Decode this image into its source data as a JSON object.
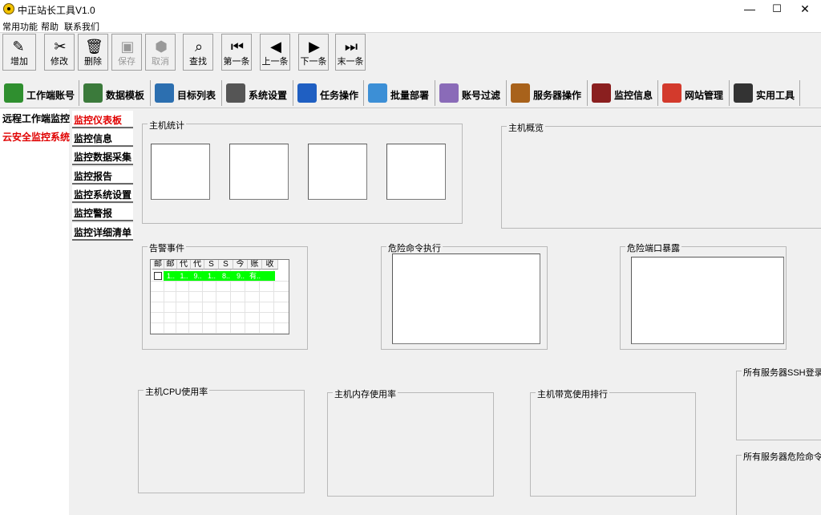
{
  "window": {
    "title": "中正站长工具V1.0",
    "controls": {
      "minimize": "—",
      "maximize": "☐",
      "close": "✕"
    }
  },
  "menu": [
    "常用功能",
    "帮助",
    "联系我们"
  ],
  "toolbar": [
    {
      "label": "增加",
      "icon": "add-icon",
      "glyph": "✎",
      "enabled": true
    },
    {
      "label": "修改",
      "icon": "edit-tools-icon",
      "glyph": "✂",
      "enabled": true
    },
    {
      "label": "删除",
      "icon": "trash-icon",
      "glyph": "🗑",
      "enabled": true
    },
    {
      "label": "保存",
      "icon": "save-icon",
      "glyph": "▣",
      "enabled": false
    },
    {
      "label": "取消",
      "icon": "cancel-icon",
      "glyph": "⬢",
      "enabled": false
    },
    {
      "label": "查找",
      "icon": "find-icon",
      "glyph": "⌕",
      "enabled": true
    },
    {
      "label": "第一条",
      "icon": "first-record-icon",
      "glyph": "⏮",
      "enabled": true
    },
    {
      "label": "上一条",
      "icon": "previous-record-icon",
      "glyph": "◀",
      "enabled": true
    },
    {
      "label": "下一条",
      "icon": "next-record-icon",
      "glyph": "▶",
      "enabled": true
    },
    {
      "label": "末一条",
      "icon": "last-record-icon",
      "glyph": "⏭",
      "enabled": true
    }
  ],
  "tabs": [
    {
      "label": "工作端账号",
      "icon": "account-card-icon",
      "color": "#2f8f2f"
    },
    {
      "label": "数据模板",
      "icon": "template-icon",
      "color": "#3b7a3b"
    },
    {
      "label": "目标列表",
      "icon": "target-folder-icon",
      "color": "#2c6fb0"
    },
    {
      "label": "系统设置",
      "icon": "wrench-icon",
      "color": "#555555"
    },
    {
      "label": "任务操作",
      "icon": "globe-icon",
      "color": "#1f5fc2"
    },
    {
      "label": "批量部署",
      "icon": "deploy-icon",
      "color": "#3c8fd6"
    },
    {
      "label": "账号过滤",
      "icon": "filter-folder-icon",
      "color": "#8a6bb8"
    },
    {
      "label": "服务器操作",
      "icon": "server-icon",
      "color": "#a8621b"
    },
    {
      "label": "监控信息",
      "icon": "monitor-icon",
      "color": "#8a1f1f"
    },
    {
      "label": "网站管理",
      "icon": "chrome-icon",
      "color": "#d33a2c"
    },
    {
      "label": "实用工具",
      "icon": "radiation-icon",
      "color": "#333333"
    }
  ],
  "left_nav": [
    {
      "label": "远程工作端监控",
      "color": "#000000"
    },
    {
      "label": "云安全监控系统",
      "color": "#e00000"
    }
  ],
  "sub_nav": [
    {
      "label": "监控仪表板",
      "color": "#e00000"
    },
    {
      "label": "监控信息",
      "color": "#000000"
    },
    {
      "label": "监控数据采集",
      "color": "#000000"
    },
    {
      "label": "监控报告",
      "color": "#000000"
    },
    {
      "label": "监控系统设置",
      "color": "#000000"
    },
    {
      "label": "监控警报",
      "color": "#000000"
    },
    {
      "label": "监控详细清单",
      "color": "#000000"
    }
  ],
  "panels": {
    "host_stats": "主机统计",
    "host_overview": "主机概览",
    "alarm_events": "告警事件",
    "danger_cmd": "危险命令执行",
    "danger_port": "危险端口暴露",
    "cpu": "主机CPU使用率",
    "memory": "主机内存使用率",
    "bandwidth": "主机带宽使用排行",
    "ssh_login": "所有服务器SSH登录次数",
    "danger_cmd_all": "所有服务器危险命令执行"
  },
  "alarm_grid": {
    "headers": [
      "邮",
      "邮",
      "代",
      "代",
      "S",
      "S",
      "今",
      "账",
      "收"
    ],
    "row": [
      "1..",
      "1..",
      "9..",
      "1..",
      "8..",
      "9..",
      "有.."
    ],
    "highlight": "#00ff00"
  }
}
